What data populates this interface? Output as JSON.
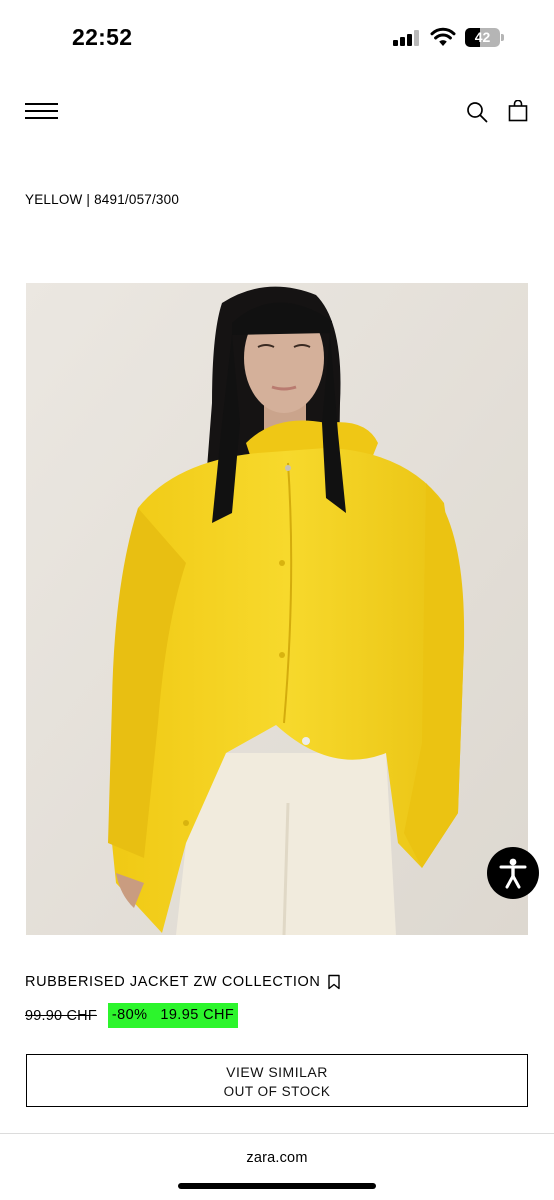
{
  "status_bar": {
    "time": "22:52",
    "battery_percent": "42",
    "battery_level": 0.42,
    "signal_bars_active": 3,
    "signal_bars_total": 4
  },
  "header": {
    "menu_icon": "hamburger-icon",
    "search_icon": "search-icon",
    "bag_icon": "shopping-bag-icon"
  },
  "product": {
    "color_reference": "YELLOW | 8491/057/300",
    "name": "RUBBERISED JACKET ZW COLLECTION",
    "original_price": "99.90 CHF",
    "discount": "-80%",
    "sale_price": "19.95 CHF",
    "bookmark_icon": "bookmark-icon"
  },
  "actions": {
    "view_similar_label": "VIEW SIMILAR",
    "out_of_stock_label": "OUT OF STOCK"
  },
  "footer": {
    "domain": "zara.com"
  },
  "colors": {
    "sale_highlight": "#2cf52c",
    "text": "#000000",
    "background": "#ffffff",
    "jacket_yellow": "#f4d21f"
  }
}
